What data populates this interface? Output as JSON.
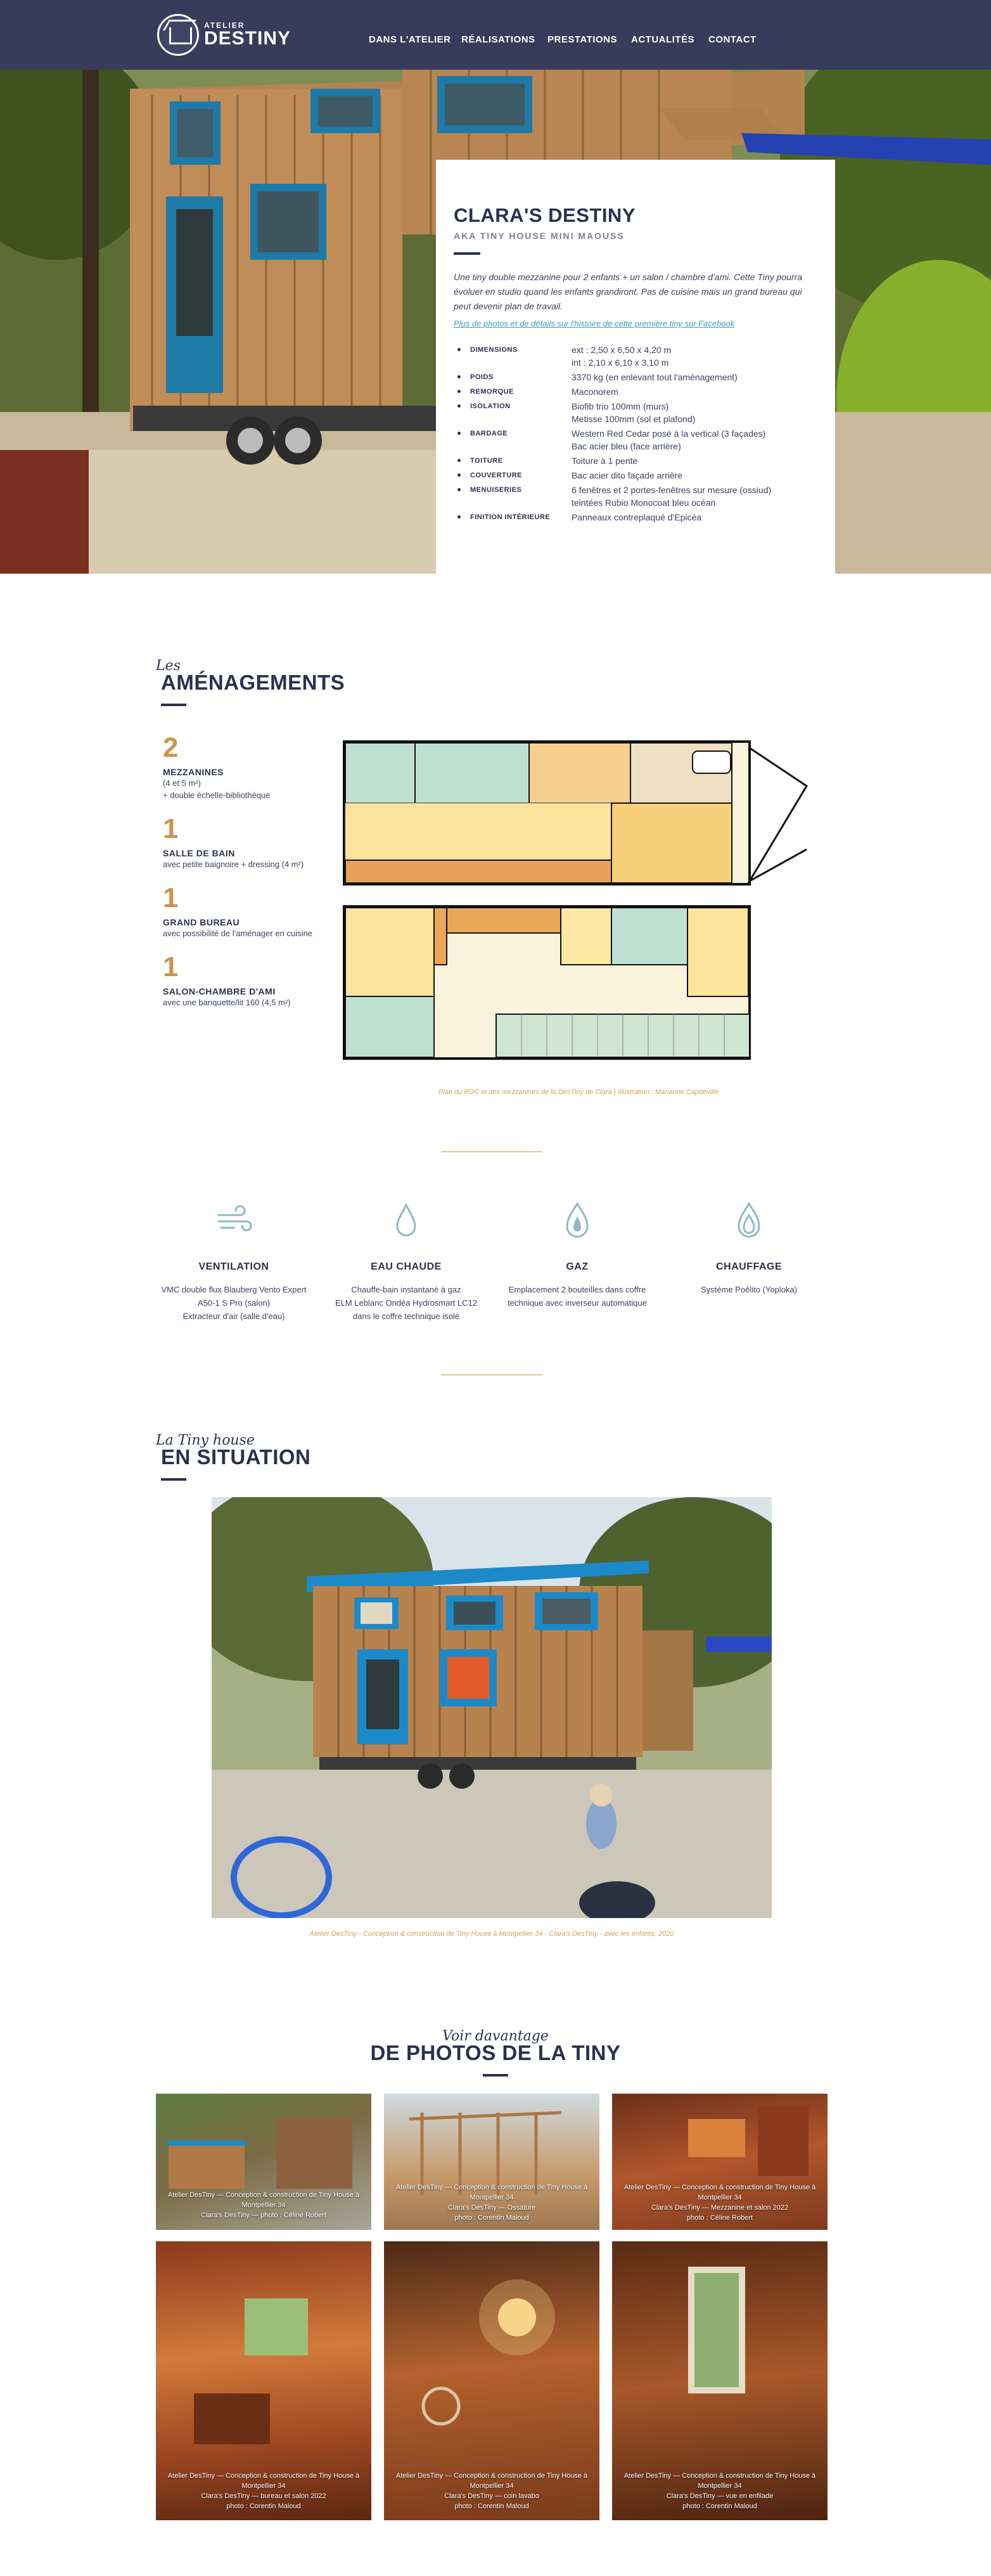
{
  "nav": {
    "logo_small": "ATELIER",
    "logo_big": "DESTINY",
    "items": [
      "DANS L'ATELIER",
      "RÉALISATIONS",
      "PRESTATIONS",
      "ACTUALITÉS",
      "CONTACT"
    ]
  },
  "card": {
    "title": "CLARA'S DESTINY",
    "subtitle": "AKA TINY HOUSE MINI MAOUSS",
    "description": "Une tiny double mezzanine pour 2 enfants + un salon / chambre d'ami. Cette Tiny pourra évoluer en studio quand les enfants grandiront. Pas de cuisine mais un grand bureau qui peut devenir plan de travail.",
    "link": "Plus de photos et de détails sur l'histoire de cette première tiny sur Facebook",
    "specs": [
      {
        "k": "DIMENSIONS",
        "v": "ext : 2,50 x 6,50 x 4,20 m\nint : 2,10 x 6,10 x 3,10 m"
      },
      {
        "k": "POIDS",
        "v": "3370 kg (en enlevant tout l'aménagement)"
      },
      {
        "k": "REMORQUE",
        "v": "Maconorem"
      },
      {
        "k": "ISOLATION",
        "v": "Biofib trio 100mm (murs)\nMetisse 100mm (sol et plafond)"
      },
      {
        "k": "BARDAGE",
        "v": "Western Red Cedar posé à la vertical (3 façades)\nBac acier bleu (face arrière)"
      },
      {
        "k": "TOITURE",
        "v": "Toiture à 1 pente"
      },
      {
        "k": "COUVERTURE",
        "v": "Bac acier dito façade arrière"
      },
      {
        "k": "MENUISERIES",
        "v": "6 fenêtres et 2 portes-fenêtres sur mesure (ossiud)\nteintées Rubio Monocoat bleu océan"
      },
      {
        "k": "FINITION INTÉRIEURE",
        "v": "Panneaux contreplaqué d'Epicéa"
      }
    ]
  },
  "amenagements": {
    "kicker": "Les",
    "title": "AMÉNAGEMENTS",
    "items": [
      {
        "num": "2",
        "name": "MEZZANINES",
        "detail": "(4 et 5 m²)\n+ double échelle-bibliothèque"
      },
      {
        "num": "1",
        "name": "SALLE DE BAIN",
        "detail": "avec petite baignoire + dressing (4 m²)"
      },
      {
        "num": "1",
        "name": "GRAND BUREAU",
        "detail": "avec possibilité de l'aménager en cuisine"
      },
      {
        "num": "1",
        "name": "SALON-CHAMBRE D'AMI",
        "detail": "avec une banquette/lit 160 (4,5 m²)"
      }
    ],
    "caption": "Plan du RDC et des mezzanines de la DesTiny de Clara | Illustration : Marianne Capdeville"
  },
  "utilities": [
    {
      "icon": "wind-icon",
      "title": "VENTILATION",
      "desc": "VMC double flux Blauberg Vento Expert\nA50-1 S Pro (salon)\nExtracteur d'air (salle d'eau)"
    },
    {
      "icon": "water-drop-icon",
      "title": "EAU CHAUDE",
      "desc": "Chauffe-bain instantané à gaz\nELM Leblanc Ondéa Hydrosmart LC12\ndans le coffre technique isolé"
    },
    {
      "icon": "gas-flame-icon",
      "title": "GAZ",
      "desc": "Emplacement 2 bouteilles dans coffre\ntechnique avec inverseur automatique"
    },
    {
      "icon": "heating-flame-icon",
      "title": "CHAUFFAGE",
      "desc": "Système Poêlito (Yoploka)"
    }
  ],
  "situation": {
    "kicker": "La Tiny house",
    "title": "EN SITUATION",
    "caption": "Atelier DesTiny - Conception & construction de Tiny House à Montpellier 34 - Clara's DesTiny - avec les enfants, 2020"
  },
  "gallery": {
    "kicker": "Voir davantage",
    "title": "DE PHOTOS DE LA TINY",
    "items": [
      {
        "l1": "Atelier DesTiny — Conception & construction de Tiny House à Montpellier 34",
        "l2": "Clara's DesTiny — photo : Céline Robert"
      },
      {
        "l1": "Atelier DesTiny — Conception & construction de Tiny House à Montpellier 34",
        "l2": "Clara's DesTiny — Ossature",
        "l3": "photo : Corentin Maloud"
      },
      {
        "l1": "Atelier DesTiny — Conception & construction de Tiny House à Montpellier 34",
        "l2": "Clara's DesTiny — Mezzanine et salon 2022",
        "l3": "photo : Céline Robert"
      },
      {
        "l1": "Atelier DesTiny — Conception & construction de Tiny House à Montpellier 34",
        "l2": "Clara's DesTiny — bureau et salon 2022",
        "l3": "photo : Corentin Maloud"
      },
      {
        "l1": "Atelier DesTiny — Conception & construction de Tiny House à Montpellier 34",
        "l2": "Clara's DesTiny — coin lavabo",
        "l3": "photo : Corentin Maloud"
      },
      {
        "l1": "Atelier DesTiny — Conception & construction de Tiny House à Montpellier 34",
        "l2": "Clara's DesTiny — vue en enfilade",
        "l3": "photo : Corentin Maloud"
      }
    ]
  }
}
